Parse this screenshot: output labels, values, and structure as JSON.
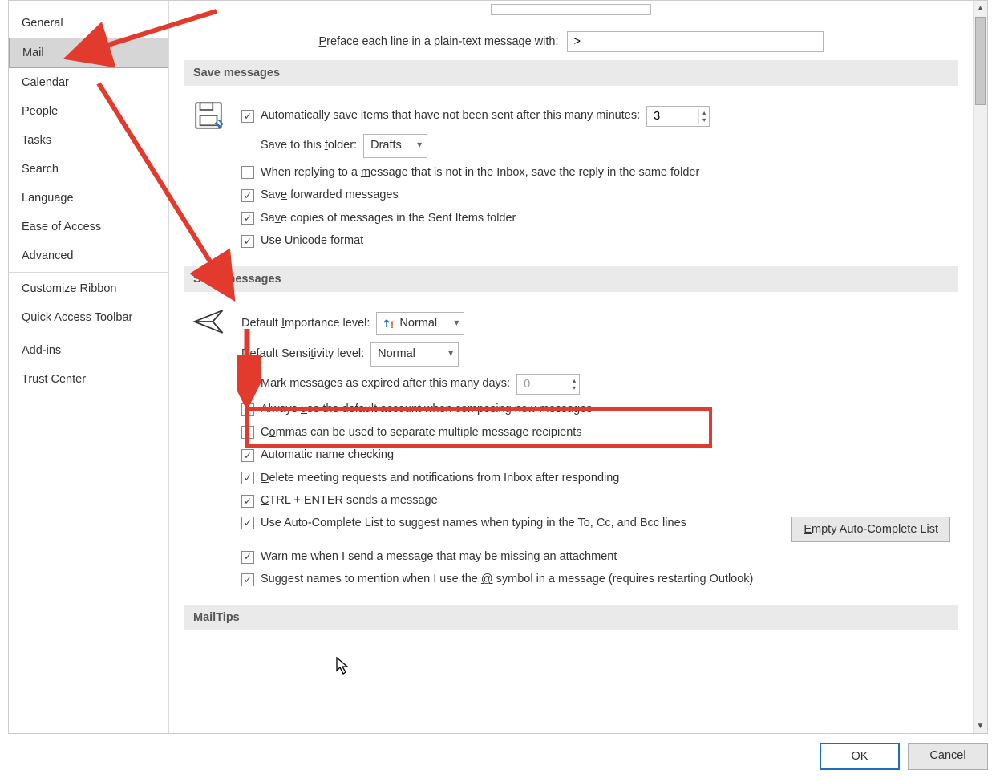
{
  "sidebar": {
    "items": [
      {
        "label": "General"
      },
      {
        "label": "Mail"
      },
      {
        "label": "Calendar"
      },
      {
        "label": "People"
      },
      {
        "label": "Tasks"
      },
      {
        "label": "Search"
      },
      {
        "label": "Language"
      },
      {
        "label": "Ease of Access"
      },
      {
        "label": "Advanced"
      },
      {
        "label": "Customize Ribbon"
      },
      {
        "label": "Quick Access Toolbar"
      },
      {
        "label": "Add-ins"
      },
      {
        "label": "Trust Center"
      }
    ],
    "selected_index": 1
  },
  "preface": {
    "label_pre": "P",
    "label_rest": "reface each line in a plain-text message with:",
    "value": ">"
  },
  "sections": {
    "save": {
      "title": "Save messages",
      "auto_save_label": "Automatically save items that have not been sent after this many minutes:",
      "auto_save_minutes": "3",
      "save_to_label": "Save to this folder:",
      "save_to_value": "Drafts",
      "reply_same_folder": "When replying to a message that is not in the Inbox, save the reply in the same folder",
      "save_forwarded": "Save forwarded messages",
      "save_sent": "Save copies of messages in the Sent Items folder",
      "use_unicode": "Use Unicode format"
    },
    "send": {
      "title": "Send messages",
      "importance_label": "Default Importance level:",
      "importance_value": "Normal",
      "sensitivity_label": "Default Sensitivity level:",
      "sensitivity_value": "Normal",
      "expire_label": "Mark messages as expired after this many days:",
      "expire_days": "0",
      "always_default_account": "Always use the default account when composing new messages",
      "commas_separate": "Commas can be used to separate multiple message recipients",
      "auto_name_check": "Automatic name checking",
      "delete_meeting": "Delete meeting requests and notifications from Inbox after responding",
      "ctrl_enter": "CTRL + ENTER sends a message",
      "autocomplete": "Use Auto-Complete List to suggest names when typing in the To, Cc, and Bcc lines",
      "empty_autocomplete_btn": "Empty Auto-Complete List",
      "warn_attachment": "Warn me when I send a message that may be missing an attachment",
      "suggest_mentions": "Suggest names to mention when I use the @ symbol in a message (requires restarting Outlook)"
    },
    "mailtips": {
      "title": "MailTips"
    }
  },
  "footer": {
    "ok": "OK",
    "cancel": "Cancel"
  }
}
